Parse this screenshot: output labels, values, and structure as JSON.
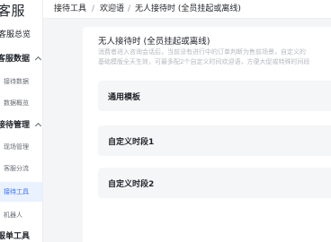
{
  "sidebar": {
    "brand": "客服",
    "items": [
      {
        "label": "客服总览"
      },
      {
        "label": "客服数据"
      },
      {
        "label": "接待数据"
      },
      {
        "label": "数据概览"
      },
      {
        "label": "接待管理"
      },
      {
        "label": "现场管理"
      },
      {
        "label": "客服分流"
      },
      {
        "label": "接待工具"
      },
      {
        "label": "机器人"
      },
      {
        "label": "服单工具"
      }
    ]
  },
  "header": {
    "crumbs": [
      "接待工具",
      "欢迎语",
      "无人接待时 (全员挂起或离线)"
    ],
    "separator": "/"
  },
  "main": {
    "title": "无人接待时 (全员挂起或离线)",
    "desc_line1": "消费者进入咨询会话后，当前没有进行中的订单判断为售前场景，自定义的",
    "desc_line2": "基础模版全天生效，可最多配2个自定义时间欢迎语，方便大促或特殊时间段",
    "sections": [
      {
        "label": "通用模板"
      },
      {
        "label": "自定义时段1"
      },
      {
        "label": "自定义时段2"
      }
    ]
  },
  "colors": {
    "accent": "#3370ff",
    "active_bg": "#eaf1ff",
    "panel": "#f5f6f7",
    "page_bg": "#f4f5f7"
  }
}
